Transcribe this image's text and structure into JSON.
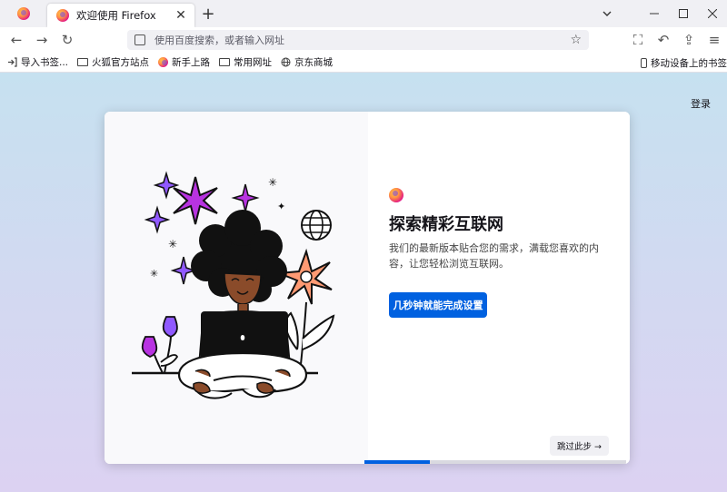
{
  "colors": {
    "accent": "#0061e0",
    "tabstrip": "#f0f0f4"
  },
  "tabs": {
    "pinned_icon": "firefox-logo",
    "active": {
      "title": "欢迎使用 Firefox",
      "close": "✕"
    },
    "new_tab": "+",
    "list_all": "⌄"
  },
  "window": {
    "minimize": "—",
    "maximize": "☐",
    "close": "✕"
  },
  "nav": {
    "back": "←",
    "forward": "→",
    "reload": "↻",
    "url_placeholder": "使用百度搜索，或者输入网址",
    "star": "☆",
    "tools": [
      "⛶",
      "↶",
      "⇪",
      "≡"
    ]
  },
  "bookmarks": {
    "items": [
      {
        "label": "导入书签...",
        "icon": "import-icon"
      },
      {
        "label": "火狐官方站点",
        "icon": "folder-icon"
      },
      {
        "label": "新手上路",
        "icon": "firefox-icon"
      },
      {
        "label": "常用网址",
        "icon": "folder-icon"
      },
      {
        "label": "京东商城",
        "icon": "globe-icon"
      }
    ],
    "mobile": "移动设备上的书签"
  },
  "content": {
    "signin": "登录",
    "card": {
      "headline": "探索精彩互联网",
      "subtitle": "我们的最新版本贴合您的需求，满载您喜欢的内容，让您轻松浏览互联网。",
      "primary_button": "几秒钟就能完成设置",
      "skip_button": "跳过此步 →",
      "progress_fraction": 0.25
    }
  }
}
